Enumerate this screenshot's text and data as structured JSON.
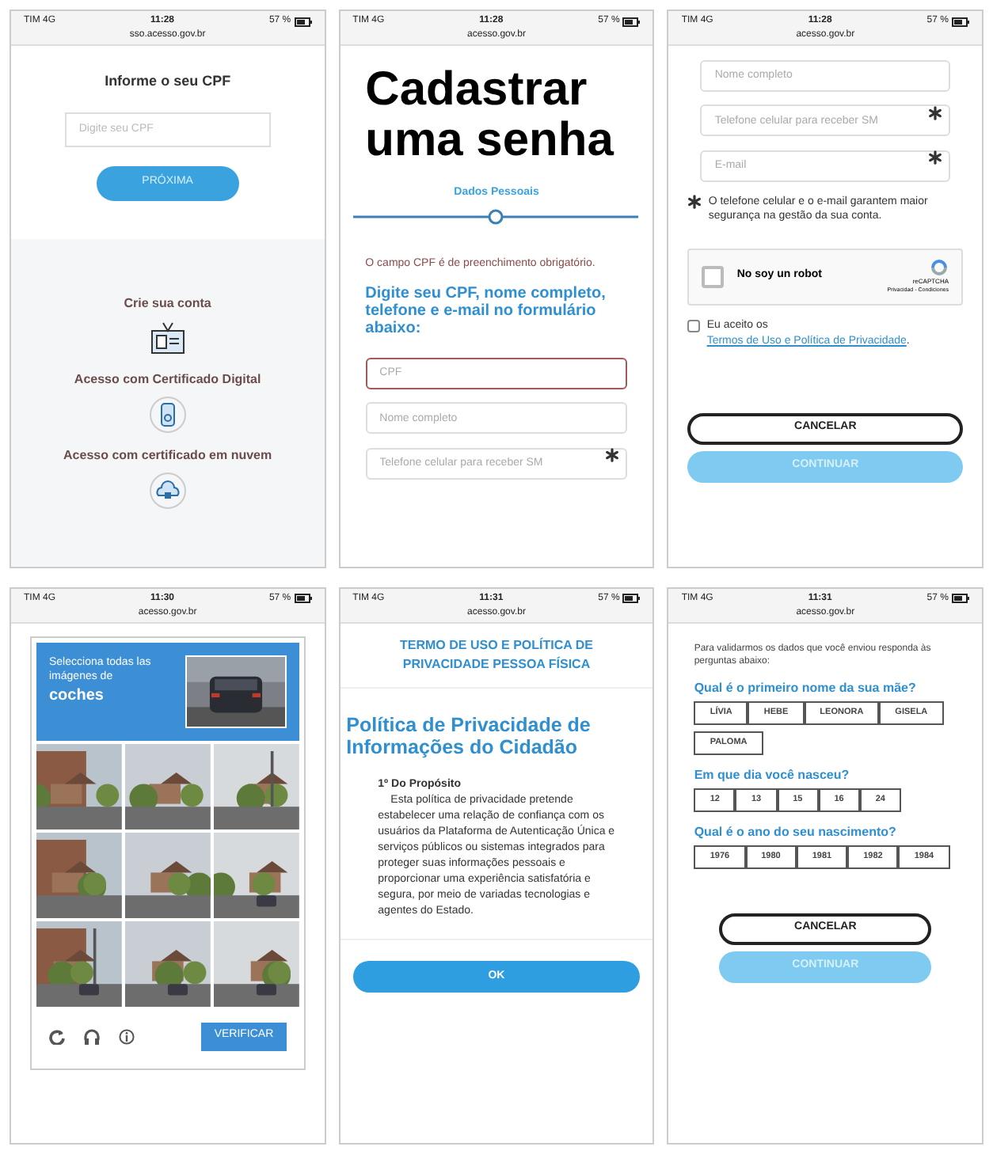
{
  "screens": [
    {
      "kind": "login",
      "status_bar": {
        "carrier": "TIM 4G",
        "time": "11:28",
        "url": "sso.acesso.gov.br",
        "battery": "57 %"
      },
      "heading": "Informe o seu CPF",
      "cpf_field": {
        "placeholder": "Digite seu CPF"
      },
      "next_button": "PRÓXIMA",
      "options": [
        "Crie sua conta",
        "Acesso com Certificado Digital",
        "Acesso com certificado em nuvem"
      ]
    },
    {
      "kind": "signup",
      "status_bar": {
        "carrier": "TIM 4G",
        "time": "11:28",
        "url": "acesso.gov.br",
        "battery": "57 %"
      },
      "title": "Cadastrar uma senha",
      "step": "Dados Pessoais",
      "error": "O campo CPF é de preenchimento obrigatório.",
      "instruction": "Digite seu CPF, nome completo, telefone e e-mail no formulário abaixo:",
      "fields": [
        {
          "placeholder": "CPF",
          "error": true,
          "required": false
        },
        {
          "placeholder": "Nome completo",
          "error": false,
          "required": false
        },
        {
          "placeholder": "Telefone celular para receber SM",
          "error": false,
          "required": true
        }
      ]
    },
    {
      "kind": "signup_more",
      "status_bar": {
        "carrier": "TIM 4G",
        "time": "11:28",
        "url": "acesso.gov.br",
        "battery": "57 %"
      },
      "fields": [
        {
          "placeholder": "Nome completo",
          "error": false,
          "required": false
        },
        {
          "placeholder": "Telefone celular para receber SM",
          "error": false,
          "required": true
        },
        {
          "placeholder": "E-mail",
          "error": false,
          "required": true
        }
      ],
      "note": "O telefone celular e o e-mail garantem maior segurança na gestão da sua conta.",
      "recaptcha": {
        "label": "No soy un robot",
        "checked": false,
        "brand": "reCAPTCHA",
        "links": "Privacidad - Condiciones"
      },
      "terms": {
        "checked": false,
        "text": "Eu aceito os",
        "link": "Termos de Uso e Política de Privacidade",
        "end": "."
      },
      "cancel_button": "CANCELAR",
      "continue_button": {
        "label": "CONTINUAR",
        "disabled": true
      }
    },
    {
      "kind": "captcha",
      "status_bar": {
        "carrier": "TIM 4G",
        "time": "11:30",
        "url": "acesso.gov.br",
        "battery": "57 %"
      },
      "prompt": "Selecciona todas las imágenes de",
      "target": "coches",
      "verify_button": "VERIFICAR"
    },
    {
      "kind": "terms",
      "status_bar": {
        "carrier": "TIM 4G",
        "time": "11:31",
        "url": "acesso.gov.br",
        "battery": "57 %"
      },
      "heading": "TERMO DE USO E POLÍTICA DE PRIVACIDADE PESSOA FÍSICA",
      "title": "Política de Privacidade de Informações do Cidadão",
      "section": "1º Do Propósito",
      "body": "Esta política de privacidade pretende estabelecer uma relação de confiança com os usuários da Plataforma de Autenticação Única e serviços públicos ou sistemas integrados para proteger suas informações pessoais e proporcionar uma experiência satisfatória e segura, por meio de variadas tecnologias e agentes do Estado.",
      "ok_button": "OK"
    },
    {
      "kind": "questions",
      "status_bar": {
        "carrier": "TIM 4G",
        "time": "11:31",
        "url": "acesso.gov.br",
        "battery": "57 %"
      },
      "intro": "Para validarmos os dados que você enviou responda às perguntas abaixo:",
      "questions": [
        {
          "question": "Qual é o primeiro nome da sua mãe?",
          "options": [
            {
              "label": "LÍVIA",
              "selected": false
            },
            {
              "label": "HEBE",
              "selected": false
            },
            {
              "label": "LEONORA",
              "selected": false
            },
            {
              "label": "GISELA",
              "selected": false
            },
            {
              "label": "PALOMA",
              "selected": false
            }
          ]
        },
        {
          "question": "Em que dia você nasceu?",
          "options": [
            {
              "label": "12",
              "selected": false
            },
            {
              "label": "13",
              "selected": false
            },
            {
              "label": "15",
              "selected": false
            },
            {
              "label": "16",
              "selected": false
            },
            {
              "label": "24",
              "selected": false
            }
          ]
        },
        {
          "question": "Qual é o ano do seu nascimento?",
          "options": [
            {
              "label": "1976",
              "selected": false
            },
            {
              "label": "1980",
              "selected": false
            },
            {
              "label": "1981",
              "selected": false
            },
            {
              "label": "1982",
              "selected": false
            },
            {
              "label": "1984",
              "selected": false
            }
          ]
        }
      ],
      "cancel_button": "CANCELAR",
      "continue_button": {
        "label": "CONTINUAR",
        "disabled": true
      }
    }
  ]
}
